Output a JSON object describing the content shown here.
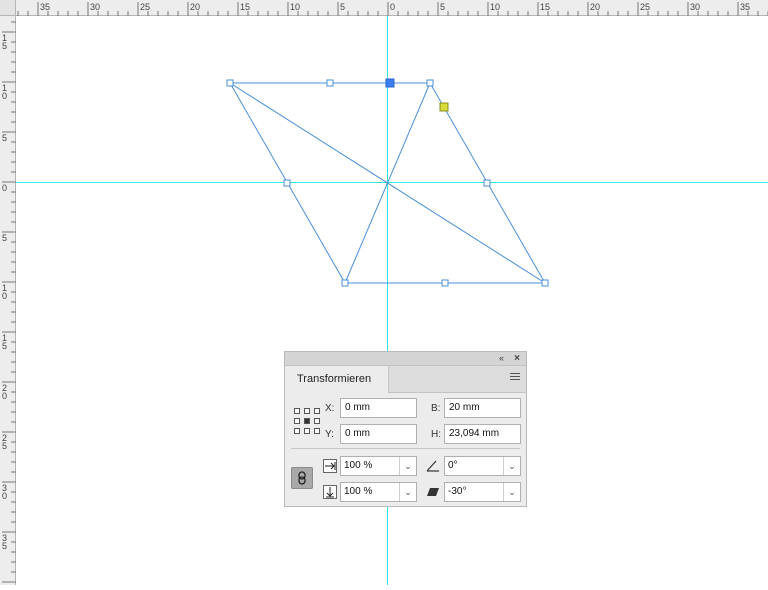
{
  "rulers": {
    "top_labels": [
      "35",
      "30",
      "25",
      "20",
      "15",
      "10",
      "5",
      "0",
      "5",
      "10",
      "15",
      "20",
      "25",
      "30",
      "35"
    ],
    "left_labels": [
      "1\n5",
      "1\n0",
      "5",
      "0",
      "5",
      "1\n0",
      "1\n5",
      "2\n0",
      "2\n5",
      "3\n0",
      "3\n5"
    ]
  },
  "colors": {
    "guide": "#2ee6e6",
    "path": "#4a90d9",
    "selected_anchor": "#3d7ef5",
    "skew_handle": "#d8dc3a"
  },
  "panel": {
    "tab_label": "Transformieren",
    "collapse_icon": "«",
    "close_icon": "×",
    "x_label": "X:",
    "x_value": "0 mm",
    "y_label": "Y:",
    "y_value": "0 mm",
    "w_label": "B:",
    "w_value": "20 mm",
    "h_label": "H:",
    "h_value": "23,094 mm",
    "scale_x": "100 %",
    "scale_y": "100 %",
    "rotate": "0°",
    "shear": "-30°"
  },
  "icons": {
    "reference_point": "reference-point-grid-icon",
    "constrain": "link-icon",
    "scale_x": "horizontal-scale-icon",
    "scale_y": "vertical-scale-icon",
    "rotate": "angle-icon",
    "shear": "shear-icon",
    "menu": "panel-menu-icon"
  }
}
